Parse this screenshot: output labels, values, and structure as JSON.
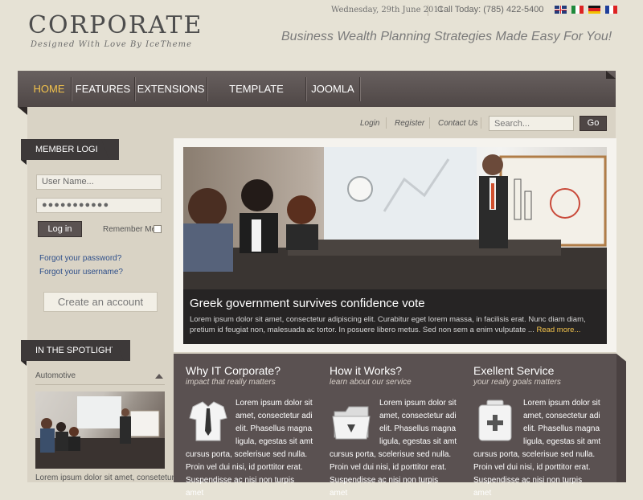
{
  "brand": {
    "title": "CORPORATE",
    "subtitle": "Designed With Love By IceTheme"
  },
  "topbar": {
    "date": "Wednesday, 29th June 2011",
    "call": "Call Today: (785) 422-5400"
  },
  "tagline": "Business Wealth Planning Strategies Made Easy For You!",
  "nav": {
    "items": [
      "HOME",
      "FEATURES",
      "EXTENSIONS",
      "TEMPLATE STYLES",
      "JOOMLA"
    ],
    "active": "HOME"
  },
  "util": {
    "login": "Login",
    "register": "Register",
    "contact": "Contact Us"
  },
  "search": {
    "placeholder": "Search...",
    "button": "Go"
  },
  "member_login": {
    "heading": "MEMBER LOGIN",
    "username_placeholder": "User Name...",
    "password_value": "●●●●●●●●●●●",
    "login_button": "Log in",
    "remember": "Remember Me",
    "forgot_password": "Forgot your password?",
    "forgot_username": "Forgot your username?",
    "create_account": "Create an account"
  },
  "spotlight": {
    "heading": "IN THE SPOTLIGHT",
    "category": "Automotive",
    "text": "Lorem ipsum dolor sit amet, consetetur"
  },
  "slide": {
    "title": "Greek government survives confidence vote",
    "text": "Lorem ipsum dolor sit amet, consectetur adipiscing elit. Curabitur eget lorem massa, in facilisis erat. Nunc diam diam, pretium id feugiat non, malesuada ac tortor. In posuere libero metus. Sed non sem a enim vulputate ...",
    "more": "Read more..."
  },
  "columns": [
    {
      "title": "Why IT Corporate?",
      "subtitle": "impact that really matters",
      "text1": "Lorem ipsum dolor sit amet, consectetur adi elit. Phasellus magna ligula, egestas sit amt",
      "text2": "cursus porta, scelerisue sed nulla. Proin vel dui nisi, id porttitor erat. Suspendisse ac nisi non turpis amet"
    },
    {
      "title": "How it Works?",
      "subtitle": "learn about our service",
      "text1": "Lorem ipsum dolor sit amet, consectetur adi elit. Phasellus magna ligula, egestas sit amt",
      "text2": "cursus porta, scelerisue sed nulla. Proin vel dui nisi, id porttitor erat. Suspendisse ac nisi non turpis amet"
    },
    {
      "title": "Exellent Service",
      "subtitle": "your really goals matters",
      "text1": "Lorem ipsum dolor sit amet, consectetur adi elit. Phasellus magna ligula, egestas sit amt",
      "text2": "cursus porta, scelerisue sed nulla. Proin vel dui nisi, id porttitor erat. Suspendisse ac nisi non turpis amet"
    }
  ],
  "colors": {
    "accent": "#f3c34c",
    "nav_bg": "#5a5251",
    "link": "#2e4f8a"
  }
}
